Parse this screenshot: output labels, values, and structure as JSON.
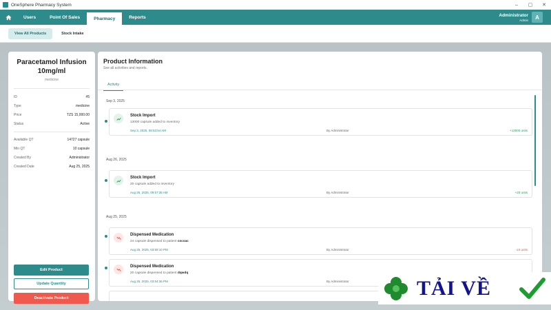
{
  "window": {
    "title": "OneSphere Pharmacy System",
    "controls": [
      "–",
      "▢",
      "✕"
    ]
  },
  "nav": {
    "items": [
      {
        "label": "Users"
      },
      {
        "label": "Point Of Sales"
      },
      {
        "label": "Pharmacy",
        "active": true
      },
      {
        "label": "Reports"
      }
    ],
    "user": {
      "name": "Administrator",
      "role": "Admin",
      "avatar": "A"
    }
  },
  "subnav": {
    "items": [
      {
        "label": "View All Products",
        "active": true
      },
      {
        "label": "Stock Intake"
      }
    ]
  },
  "product": {
    "name": "Paracetamol Infusion 10mg/ml",
    "type_label": "medicine",
    "details": [
      {
        "label": "ID",
        "value": "#5"
      },
      {
        "label": "Type",
        "value": "medicine"
      },
      {
        "label": "Price",
        "value": "TZS 15,000.00"
      },
      {
        "label": "Status",
        "value": "Active"
      }
    ],
    "stock": [
      {
        "label": "Available QT",
        "value": "14727 capsule"
      },
      {
        "label": "Min QT",
        "value": "10 capsule"
      },
      {
        "label": "Created By",
        "value": "Administrator"
      },
      {
        "label": "Created Date",
        "value": "Aug 25, 2025"
      }
    ],
    "buttons": {
      "edit": "Edit Product",
      "update": "Update Quantity",
      "deactivate": "Deactivate Product"
    }
  },
  "info": {
    "title": "Product Information",
    "subtitle": "See all activities and reports.",
    "tab": "Activity",
    "groups": [
      {
        "date": "Sep 3, 2025",
        "activities": [
          {
            "kind": "import",
            "title": "Stock Import",
            "desc_prefix": "13000 capsule added to inventory",
            "patient": "",
            "datetime": "Sep 3, 2025, 08:53:54 AM",
            "by": "By Administrator",
            "units": "+13000 units"
          }
        ]
      },
      {
        "date": "Aug 26, 2025",
        "activities": [
          {
            "kind": "import",
            "title": "Stock Import",
            "desc_prefix": "20 capsule added to inventory",
            "patient": "",
            "datetime": "Aug 26, 2025, 09:57:35 AM",
            "by": "By Administrator",
            "units": "+20 units"
          }
        ]
      },
      {
        "date": "Aug 25, 2025",
        "activities": [
          {
            "kind": "dispense",
            "title": "Dispensed Medication",
            "desc_prefix": "24 capsule dispensed to patient ",
            "patient": "cscsac",
            "datetime": "Aug 25, 2025, 03:59:10 PM",
            "by": "By Administrator",
            "units": "-24 units"
          },
          {
            "kind": "dispense",
            "title": "Dispensed Medication",
            "desc_prefix": "20 capsule dispensed to patient ",
            "patient": "dqwdq",
            "datetime": "Aug 25, 2025, 03:54:36 PM",
            "by": "By Administrator",
            "units": ""
          }
        ]
      }
    ]
  },
  "watermark": {
    "text": "TẢI VỀ"
  }
}
